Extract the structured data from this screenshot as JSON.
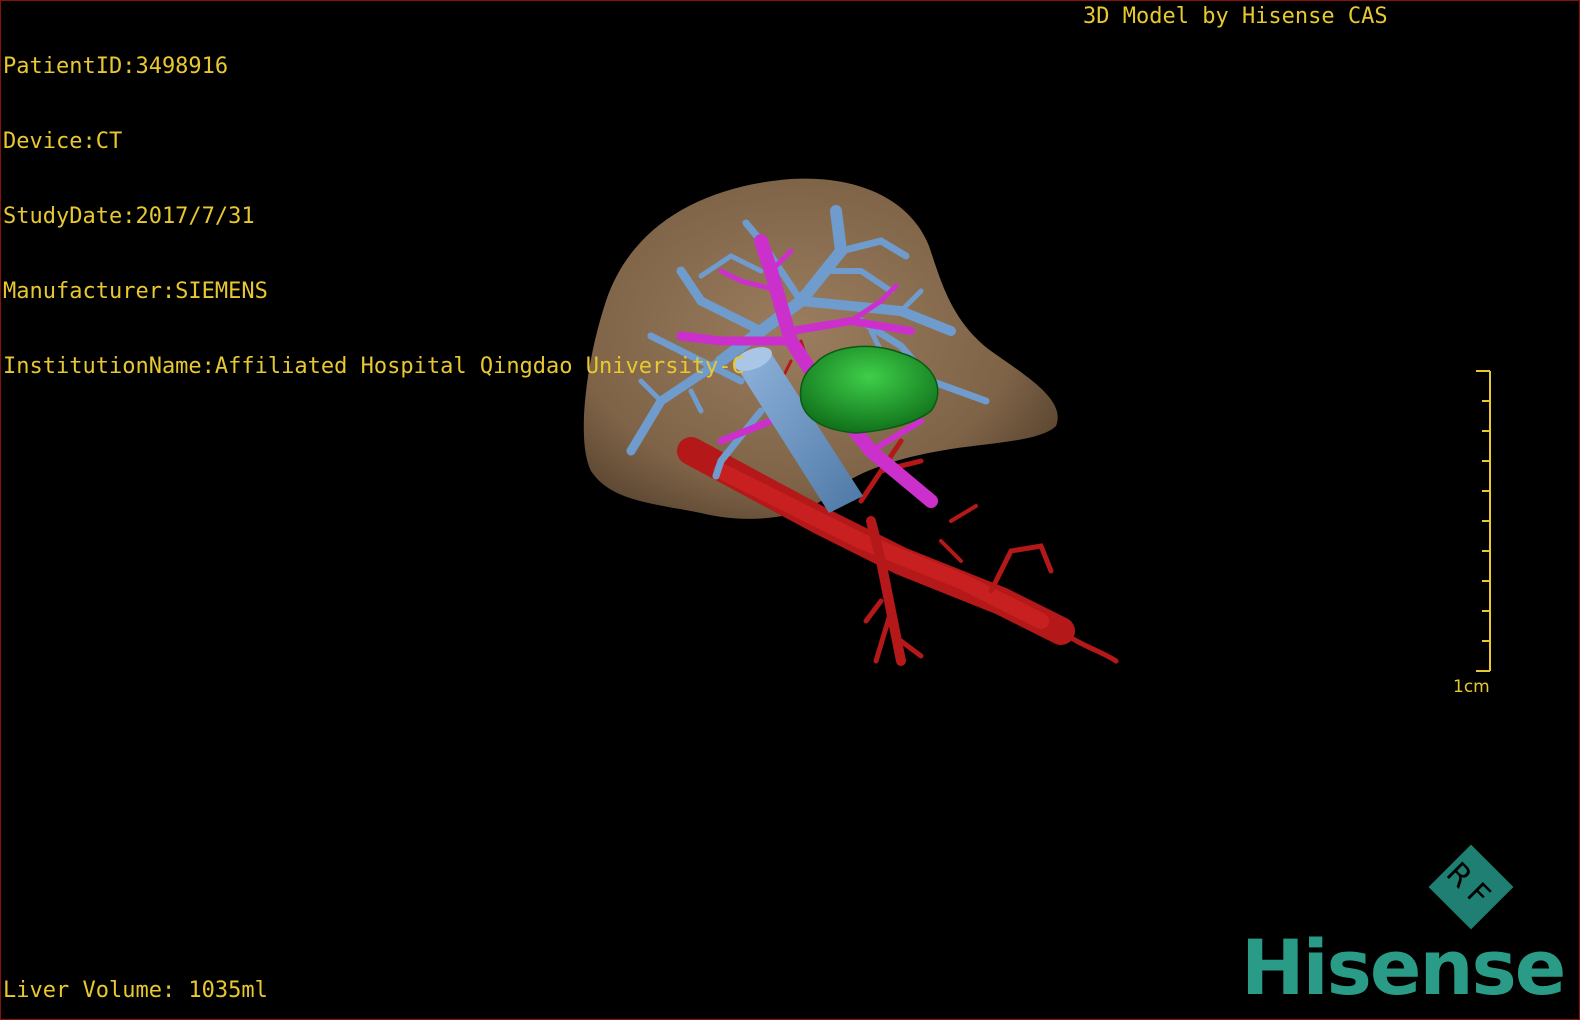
{
  "info": {
    "patient_id": "PatientID:3498916",
    "device": "Device:CT",
    "study_date": "StudyDate:2017/7/31",
    "manufacturer": "Manufacturer:SIEMENS",
    "institution": "InstitutionName:Affiliated Hospital Qingdao University-C"
  },
  "model_credit": "3D Model by Hisense CAS",
  "liver_volume": "Liver Volume: 1035ml",
  "scale": {
    "label": "1cm",
    "tick_count": 10
  },
  "badge": {
    "letters": "RF"
  },
  "brand": "Hisense",
  "colors": {
    "overlay_text": "#e8c830",
    "liver": "#9b7b59",
    "portal_vein": "#6f9ccc",
    "hepatic_vein": "#cc30cc",
    "artery": "#b41818",
    "tumor": "#1e9a2a",
    "brand": "#2a9b86"
  }
}
